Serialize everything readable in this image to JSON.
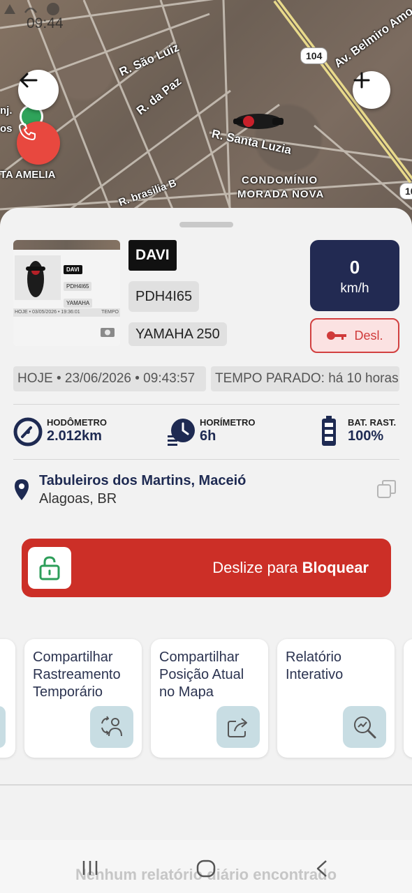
{
  "status_bar": {
    "time": "09:44"
  },
  "map": {
    "streets": [
      "R. São Luiz",
      "R. da Paz",
      "R. Santa Luzia",
      "Av. Belmiro Amo",
      "R. brasilia B"
    ],
    "places": [
      "CONDOMÍNIO",
      "MORADA NOVA",
      "TA AMELIA",
      "nj.",
      "os"
    ],
    "road_badges": [
      "104",
      "10"
    ],
    "back_icon": "arrow-left-icon",
    "zoom_icon": "plus-icon",
    "call_icon": "phone-icon",
    "call_color": "#e8483f"
  },
  "vehicle": {
    "name": "DAVI",
    "plate": "PDH4I65",
    "model": "YAMAHA 250",
    "speed_value": "0",
    "speed_unit": "km/h",
    "ignition_label": "Desl.",
    "ignition_icon": "key-icon",
    "thumb": {
      "name": "DAVI",
      "plate": "PDH4I65",
      "model": "YAMAHA",
      "bar_text": "HOJE • 03/05/2026 • 19:36:01",
      "bar_right": "TEMPO"
    }
  },
  "info": {
    "date_pill": "HOJE • 23/06/2026 • 09:43:57",
    "stopped_pill": "TEMPO PARADO: há 10 horas"
  },
  "stats": [
    {
      "label": "HODÔMETRO",
      "value": "2.012km",
      "icon": "speedometer-icon"
    },
    {
      "label": "HORÍMETRO",
      "value": "6h",
      "icon": "clock-icon"
    },
    {
      "label": "BAT. RAST.",
      "value": "100%",
      "icon": "battery-icon"
    }
  ],
  "address": {
    "line1": "Tabuleiros dos Martins, Maceió",
    "line2": "Alagoas, BR"
  },
  "slider": {
    "prefix": "Deslize para ",
    "action": "Bloquear",
    "color": "#cc2f27"
  },
  "cards": [
    {
      "title": "Compartilhar\nRastreamento\nTemporário",
      "icon": "share-users-icon"
    },
    {
      "title": "Compartilhar\nPosição Atual\nno Mapa",
      "icon": "share-arrow-icon"
    },
    {
      "title": "Relatório\nInterativo",
      "icon": "report-search-icon"
    }
  ],
  "empty_message": "Nenhum relatório diário encontrado",
  "accent_color": "#222a52"
}
